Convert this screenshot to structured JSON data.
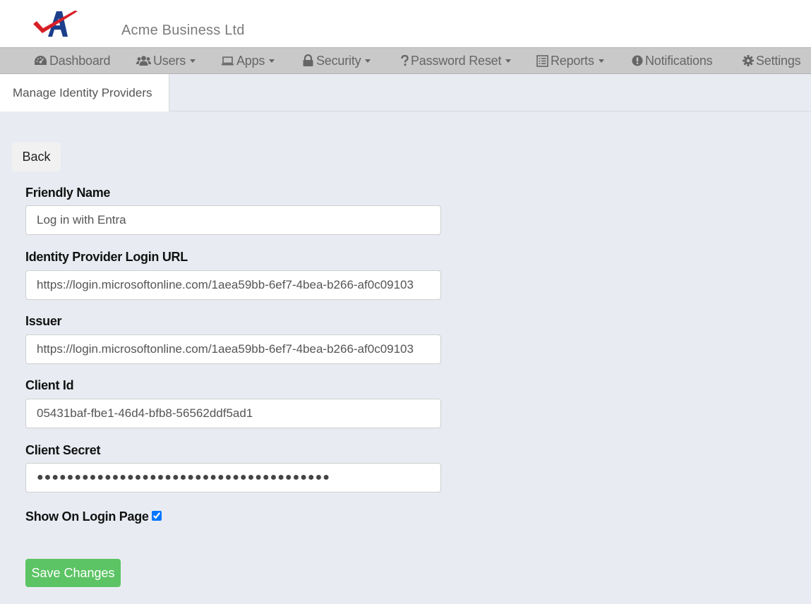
{
  "header": {
    "company_name": "Acme Business Ltd",
    "logo_letter": "A"
  },
  "nav": [
    {
      "label": "Dashboard",
      "icon": "dashboard-icon",
      "dropdown": false
    },
    {
      "label": "Users",
      "icon": "users-icon",
      "dropdown": true
    },
    {
      "label": "Apps",
      "icon": "laptop-icon",
      "dropdown": true
    },
    {
      "label": "Security",
      "icon": "lock-icon",
      "dropdown": true
    },
    {
      "label": "Password Reset",
      "icon": "question-icon",
      "dropdown": true
    },
    {
      "label": "Reports",
      "icon": "list-icon",
      "dropdown": true
    },
    {
      "label": "Notifications",
      "icon": "exclamation-circle-icon",
      "dropdown": false
    },
    {
      "label": "Settings",
      "icon": "gear-icon",
      "dropdown": false
    }
  ],
  "tabs": [
    {
      "label": "Manage Identity Providers",
      "active": true
    }
  ],
  "form": {
    "back_label": "Back",
    "friendly_name": {
      "label": "Friendly Name",
      "value": "Log in with Entra"
    },
    "login_url": {
      "label": "Identity Provider Login URL",
      "value": "https://login.microsoftonline.com/1aea59bb-6ef7-4bea-b266-af0c09103"
    },
    "issuer": {
      "label": "Issuer",
      "value": "https://login.microsoftonline.com/1aea59bb-6ef7-4bea-b266-af0c09103"
    },
    "client_id": {
      "label": "Client Id",
      "value": "05431baf-fbe1-46d4-bfb8-56562ddf5ad1"
    },
    "client_secret": {
      "label": "Client Secret",
      "value": "●●●●●●●●●●●●●●●●●●●●●●●●●●●●●●●●●●●●●●●"
    },
    "show_on_login": {
      "label": "Show On Login Page",
      "checked": true
    },
    "save_label": "Save Changes"
  },
  "colors": {
    "navbar_bg": "#c9c9c9",
    "page_bg": "#e8ecf2",
    "save_button": "#5cc464",
    "logo_blue": "#1c3f8c",
    "logo_red": "#d81f26"
  }
}
